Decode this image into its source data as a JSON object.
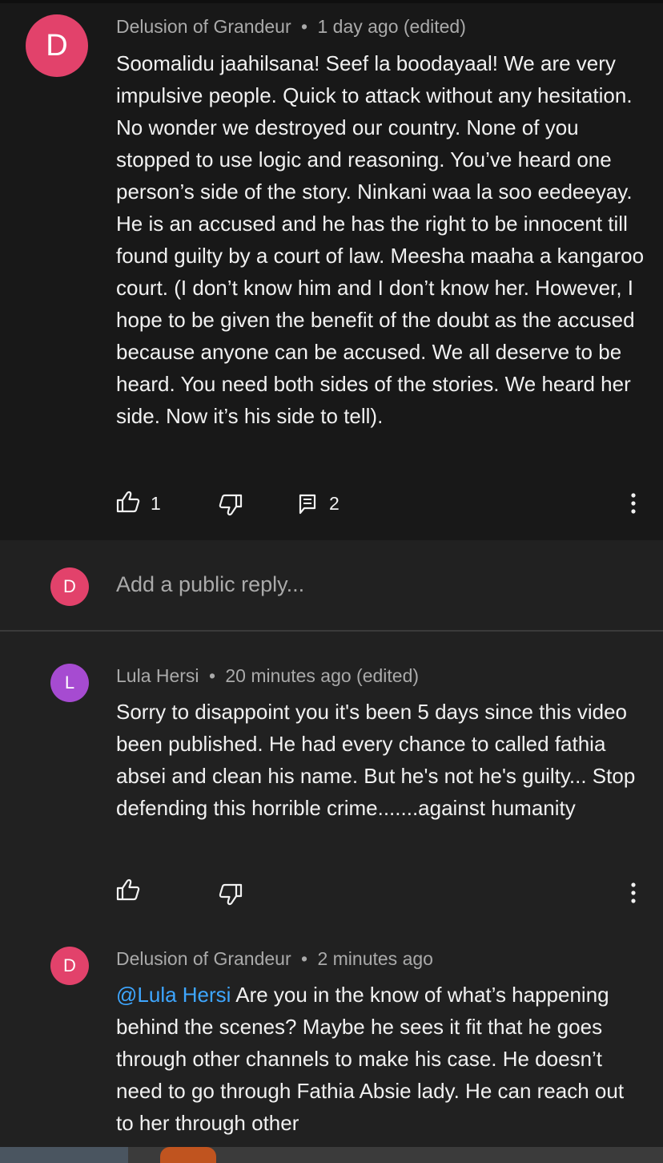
{
  "main_comment": {
    "avatar_letter": "D",
    "avatar_color": "#e2426b",
    "author": "Delusion of Grandeur",
    "separator": "•",
    "time": "1 day ago (edited)",
    "text": "Soomalidu jaahilsana! Seef la boodayaal! We are very impulsive people. Quick to attack without any hesitation. No wonder we destroyed our country. None of you stopped to use logic and reasoning. You’ve heard one person’s side of the story. Ninkani waa la soo eedeeyay. He is an accused and he has the right to be innocent till found guilty by a court of law.  Meesha maaha a kangaroo court. (I don’t know him and I don’t know her. However, I hope to be given the benefit of the doubt as the accused because anyone can be accused. We all deserve to be heard.  You need both sides of the stories. We heard her side. Now it’s his side to tell).",
    "likes": "1",
    "replies": "2",
    "icons": [
      "thumb-up-icon",
      "thumb-down-icon",
      "comment-icon",
      "more-vert-icon"
    ]
  },
  "reply_bar": {
    "avatar_letter": "D",
    "avatar_color": "#e2426b",
    "placeholder": "Add a public reply..."
  },
  "replies": [
    {
      "avatar_letter": "L",
      "avatar_color": "#a64bd1",
      "author": "Lula Hersi",
      "separator": "•",
      "time": "20 minutes ago (edited)",
      "text": "Sorry to disappoint you  it's been 5 days since this video been  published.  He had every chance to called fathia absei and  clean his name.  But he's not he's guilty... Stop defending  this horrible crime.......against humanity"
    },
    {
      "avatar_letter": "D",
      "avatar_color": "#e2426b",
      "author": "Delusion of Grandeur",
      "separator": "•",
      "time": "2 minutes ago",
      "mention": "@Lula Hersi",
      "text": " Are you in the know of what’s happening behind the scenes?  Maybe he sees it fit that he goes through other channels to make his case. He doesn’t need to go through Fathia Absie lady. He can reach out to her through other"
    }
  ],
  "colors": {
    "background": "#212121",
    "main_comment_bg": "#181818",
    "meta_text": "#aaaaaa",
    "mention": "#3ea6ff"
  }
}
